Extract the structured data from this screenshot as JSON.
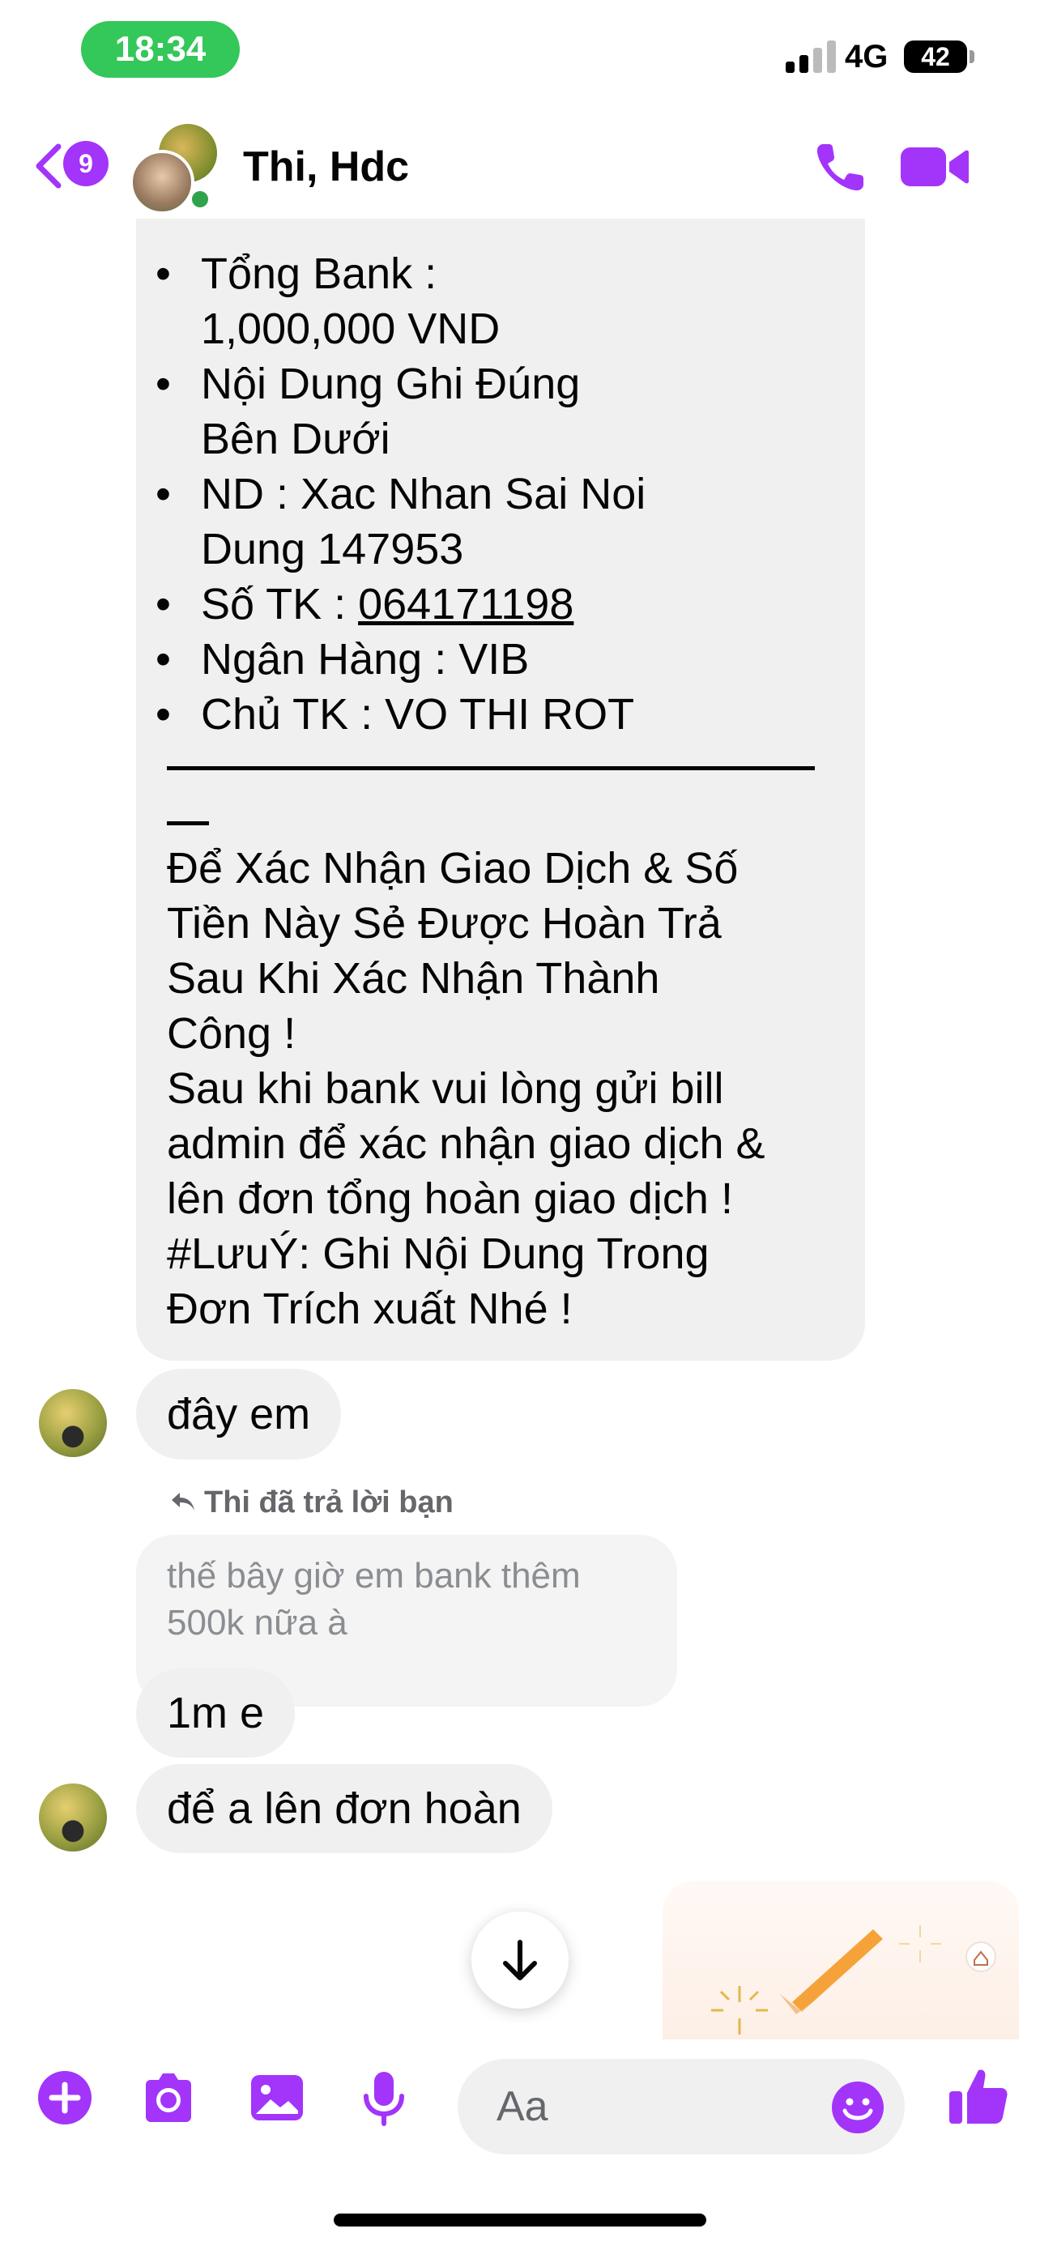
{
  "status_bar": {
    "time": "18:34",
    "network": "4G",
    "battery": "42"
  },
  "header": {
    "unread_count": "9",
    "title": "Thi, Hdc"
  },
  "messages": {
    "main_list": [
      {
        "text": "Tổng Bank : \n1,000,000 VND"
      },
      {
        "text": "Nội Dung Ghi Đúng \nBên Dưới"
      },
      {
        "text": "ND : Xac Nhan Sai Noi \nDung 147953"
      },
      {
        "prefix": "Số TK : ",
        "link": "064171198"
      },
      {
        "text": "Ngân Hàng : VIB"
      },
      {
        "text": "Chủ TK : VO THI ROT"
      }
    ],
    "main_body": "Để Xác Nhận Giao Dịch & Số \nTiền Này Sẻ Được Hoàn Trả \nSau Khi Xác Nhận Thành \nCông !\nSau khi bank vui lòng gửi bill \nadmin để xác nhận giao dịch & \nlên đơn tổng hoàn giao dịch !\n#LưuÝ: Ghi Nội Dung Trong \nĐơn Trích xuất Nhé !",
    "reply_1": "đây em",
    "reply_label": "Thi đã trả lời bạn",
    "quoted_text": "thế bây giờ em bank thêm \n500k nữa à",
    "reply_2": "1m e",
    "reply_3": "để a lên đơn hoàn"
  },
  "composer": {
    "placeholder": "Aa"
  },
  "colors": {
    "accent": "#a334fa",
    "bubble": "#f0f0f0",
    "status_green": "#34c759",
    "online": "#31a24c"
  },
  "icons": [
    "back-icon",
    "phone-icon",
    "video-camera-icon",
    "reply-arrow-icon",
    "arrow-down-icon",
    "plus-icon",
    "camera-icon",
    "gallery-icon",
    "microphone-icon",
    "emoji-icon",
    "thumbs-up-icon"
  ]
}
